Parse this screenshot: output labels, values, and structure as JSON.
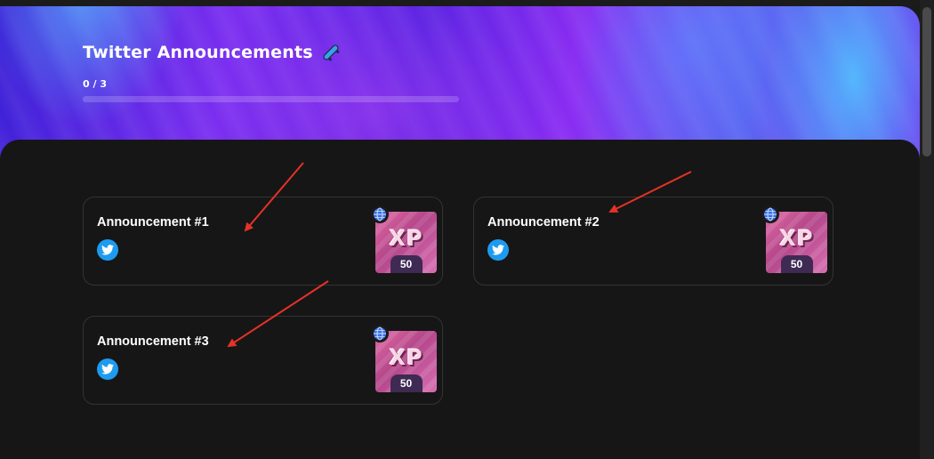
{
  "header": {
    "title": "Twitter Announcements",
    "title_icon": "skateboard-icon",
    "progress_text": "0 / 3",
    "progress_fraction": 0
  },
  "cards": [
    {
      "title": "Announcement #1",
      "platform_icon": "twitter-icon",
      "badge_icon": "globe-icon",
      "reward_label": "XP",
      "reward_value": "50"
    },
    {
      "title": "Announcement #2",
      "platform_icon": "twitter-icon",
      "badge_icon": "globe-icon",
      "reward_label": "XP",
      "reward_value": "50"
    },
    {
      "title": "Announcement #3",
      "platform_icon": "twitter-icon",
      "badge_icon": "globe-icon",
      "reward_label": "XP",
      "reward_value": "50"
    }
  ],
  "colors": {
    "panel_bg": "#161616",
    "twitter_blue": "#1d9bf0",
    "arrow_red": "#e53227",
    "xp_badge_bg": "#3e2a53"
  }
}
